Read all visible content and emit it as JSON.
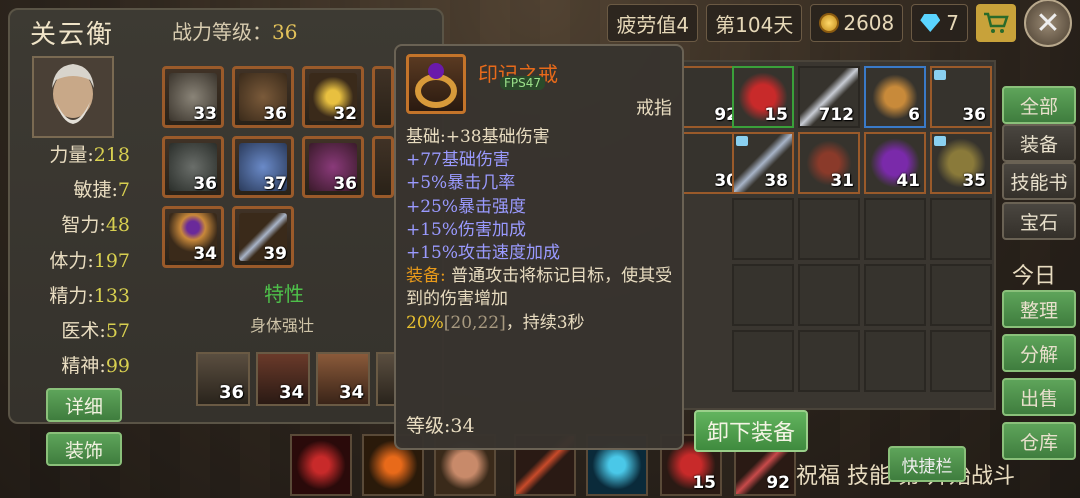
{
  "topbar": {
    "fatigue": "疲劳值4",
    "day": "第104天",
    "gold": "2608",
    "gems": "7"
  },
  "character": {
    "name": "关云衡",
    "power_label": "战力等级：",
    "power_value": "36",
    "stats": [
      {
        "name": "力量:",
        "value": "218"
      },
      {
        "name": "敏捷:",
        "value": "7"
      },
      {
        "name": "智力:",
        "value": "48"
      },
      {
        "name": "体力:",
        "value": "197"
      },
      {
        "name": "精力:",
        "value": "133"
      },
      {
        "name": "医术:",
        "value": "57"
      },
      {
        "name": "精神:",
        "value": "99"
      }
    ],
    "detail_button": "详细",
    "decoration_button": "装饰",
    "trait_title": "特性",
    "trait_value": "身体强壮"
  },
  "equipment_levels": [
    "33",
    "36",
    "32",
    "36",
    "37",
    "36",
    "34",
    "39"
  ],
  "heroes": [
    "36",
    "34",
    "34"
  ],
  "inventory_levels": {
    "row1": [
      "92",
      "15",
      "712",
      "6",
      "36"
    ],
    "row2": [
      "30",
      "38",
      "31",
      "41",
      "35"
    ]
  },
  "tooltip": {
    "name": "印记之戒",
    "fps": "FPS47",
    "type": "戒指",
    "base": "基础:+38基础伤害",
    "attrs": [
      "+77基础伤害",
      "+5%暴击几率",
      "+25%暴击强度",
      "+15%伤害加成",
      "+15%攻击速度加成"
    ],
    "equip_label": "装备:",
    "equip_text_1": " 普通攻击将标记目标，使其受到的伤害增加",
    "equip_pct": "20%",
    "equip_range": "[20,22]",
    "equip_text_2": "，持续3秒",
    "level": "等级:34"
  },
  "unequip_button": "卸下装备",
  "tabs": [
    "全部",
    "装备",
    "技能书",
    "宝石",
    "整理",
    "分解",
    "出售",
    "仓库"
  ],
  "today_label": "今日",
  "quick_bar_button": "快捷栏",
  "bottom": {
    "hotbar_levels": [
      "15",
      "92"
    ],
    "text": "祝福 技能 第 开始战斗"
  },
  "icons": {
    "close": "close-icon",
    "cart": "cart-icon",
    "gold": "gold-coin-icon",
    "gem": "gem-icon"
  }
}
